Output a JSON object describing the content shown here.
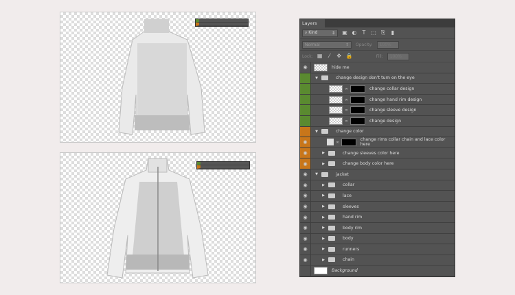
{
  "panel": {
    "title": "Layers",
    "filter_kind": "Kind",
    "blend_mode": "Normal",
    "opacity_label": "Opacity:",
    "opacity_value": "100%",
    "lock_label": "Lock:",
    "fill_label": "Fill:",
    "fill_value": "100%"
  },
  "layers": [
    {
      "name": "hide me",
      "type": "layer",
      "indent": 0,
      "tag": "none",
      "eye": true
    },
    {
      "name": "change design don't turn on the eye",
      "type": "group",
      "open": true,
      "indent": 0,
      "tag": "green",
      "eye": false
    },
    {
      "name": "change collar design",
      "type": "smart",
      "indent": 1,
      "tag": "green",
      "eye": false
    },
    {
      "name": "change hand rim design",
      "type": "smart",
      "indent": 1,
      "tag": "green",
      "eye": false
    },
    {
      "name": "change sleeve design",
      "type": "smart",
      "indent": 1,
      "tag": "green",
      "eye": false
    },
    {
      "name": "change design",
      "type": "smart",
      "indent": 1,
      "tag": "green",
      "eye": false
    },
    {
      "name": "change color",
      "type": "group",
      "open": true,
      "indent": 0,
      "tag": "orange",
      "eye": false
    },
    {
      "name": "change rims collar chain and lace color here",
      "type": "fill",
      "indent": 1,
      "tag": "orange",
      "eye": true
    },
    {
      "name": "change sleeves color here",
      "type": "group",
      "open": false,
      "indent": 1,
      "tag": "orange",
      "eye": true
    },
    {
      "name": "change body color here",
      "type": "group",
      "open": false,
      "indent": 1,
      "tag": "orange",
      "eye": true
    },
    {
      "name": "jacket",
      "type": "group",
      "open": true,
      "indent": 0,
      "tag": "none",
      "eye": true
    },
    {
      "name": "collar",
      "type": "group",
      "open": false,
      "indent": 1,
      "tag": "none",
      "eye": true
    },
    {
      "name": "lace",
      "type": "group",
      "open": false,
      "indent": 1,
      "tag": "none",
      "eye": true
    },
    {
      "name": "sleeves",
      "type": "group",
      "open": false,
      "indent": 1,
      "tag": "none",
      "eye": true
    },
    {
      "name": "hand rim",
      "type": "group",
      "open": false,
      "indent": 1,
      "tag": "none",
      "eye": true
    },
    {
      "name": "body rim",
      "type": "group",
      "open": false,
      "indent": 1,
      "tag": "none",
      "eye": true
    },
    {
      "name": "body",
      "type": "group",
      "open": false,
      "indent": 1,
      "tag": "none",
      "eye": true
    },
    {
      "name": "runners",
      "type": "group",
      "open": false,
      "indent": 1,
      "tag": "none",
      "eye": true
    },
    {
      "name": "chain",
      "type": "group",
      "open": false,
      "indent": 1,
      "tag": "none",
      "eye": true
    },
    {
      "name": "Background",
      "type": "background",
      "indent": 0,
      "tag": "none",
      "eye": false
    }
  ],
  "colors": {
    "green": "#5a8a30",
    "orange": "#c8761a",
    "panel": "#535353",
    "page": "#f1ecec"
  }
}
